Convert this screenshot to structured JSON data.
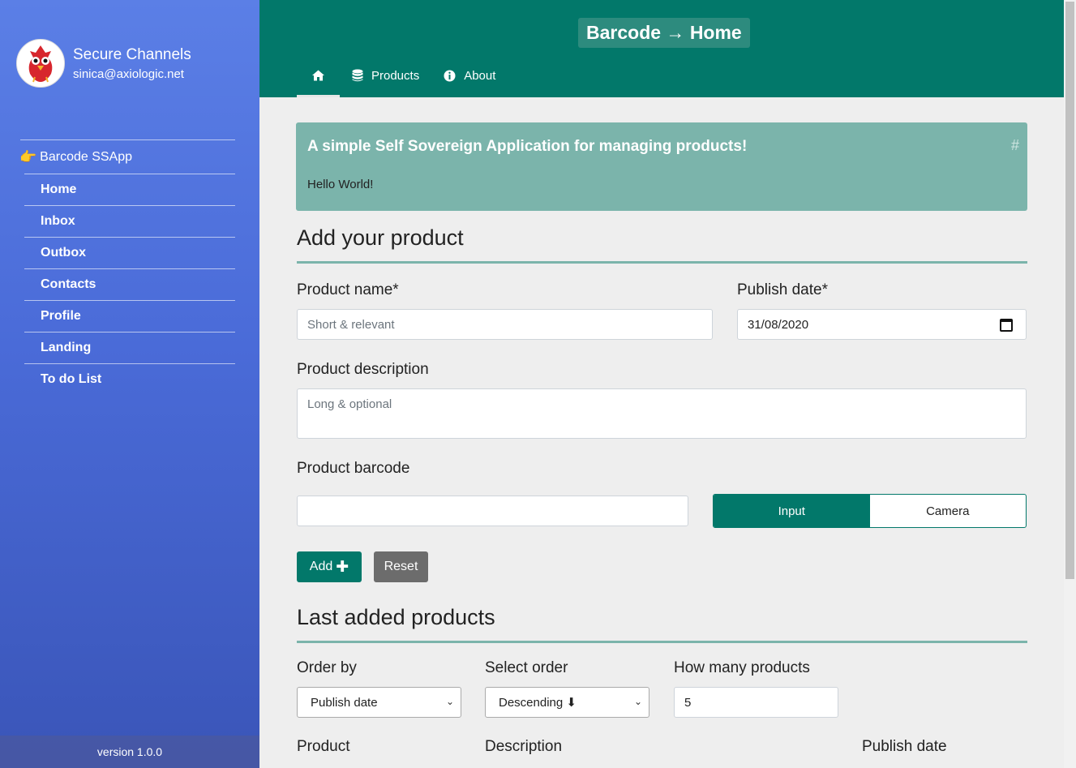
{
  "sidebar": {
    "profile_name": "Secure Channels",
    "profile_email": "sinica@axiologic.net",
    "app_label": "Barcode SSApp",
    "items": [
      {
        "label": "Home"
      },
      {
        "label": "Inbox"
      },
      {
        "label": "Outbox"
      },
      {
        "label": "Contacts"
      },
      {
        "label": "Profile"
      },
      {
        "label": "Landing"
      },
      {
        "label": "To do List"
      }
    ],
    "version": "version 1.0.0"
  },
  "header": {
    "title": "Barcode → Home",
    "tabs": [
      {
        "label": "",
        "icon": "home-icon"
      },
      {
        "label": "Products",
        "icon": "database-icon"
      },
      {
        "label": "About",
        "icon": "info-icon"
      }
    ]
  },
  "banner": {
    "title": "A simple Self Sovereign Application for managing products!",
    "hash": "#",
    "text": "Hello World!"
  },
  "add_product": {
    "title": "Add your product",
    "name_label": "Product name*",
    "name_placeholder": "Short & relevant",
    "date_label": "Publish date*",
    "date_value": "31/08/2020",
    "desc_label": "Product description",
    "desc_placeholder": "Long & optional",
    "barcode_label": "Product barcode",
    "barcode_value": "",
    "toggle_input": "Input",
    "toggle_camera": "Camera",
    "add_button": "Add",
    "reset_button": "Reset"
  },
  "last_products": {
    "title": "Last added products",
    "order_by_label": "Order by",
    "order_by_value": "Publish date",
    "select_order_label": "Select order",
    "select_order_value": "Descending ⬇",
    "how_many_label": "How many products",
    "how_many_value": "5",
    "columns": [
      "Product",
      "Description",
      "Publish date"
    ]
  },
  "colors": {
    "primary": "#02786a",
    "banner": "#7bb4ab",
    "sidebar_top": "#5b7fe6",
    "sidebar_bottom": "#3a55b8"
  }
}
